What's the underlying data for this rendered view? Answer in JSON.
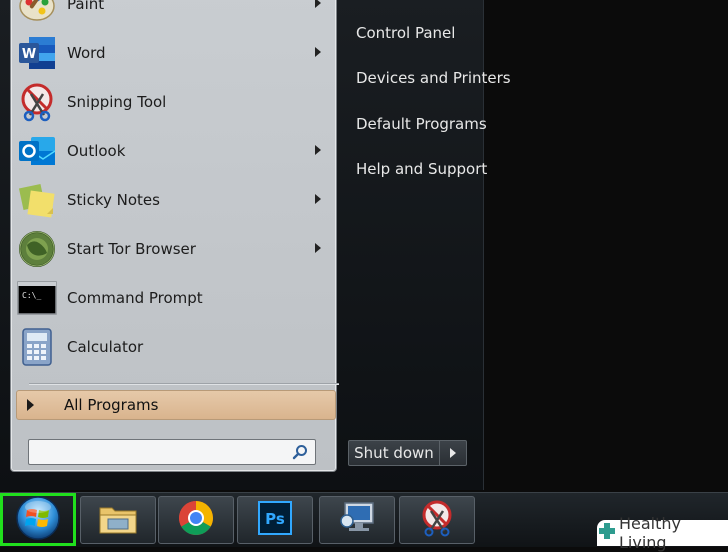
{
  "start_menu": {
    "programs": [
      {
        "label": "Paint",
        "icon": "paint-icon",
        "has_submenu": true
      },
      {
        "label": "Word",
        "icon": "word-icon",
        "has_submenu": true
      },
      {
        "label": "Snipping Tool",
        "icon": "snipping-tool-icon",
        "has_submenu": false
      },
      {
        "label": "Outlook",
        "icon": "outlook-icon",
        "has_submenu": true
      },
      {
        "label": "Sticky Notes",
        "icon": "sticky-notes-icon",
        "has_submenu": true
      },
      {
        "label": "Start Tor Browser",
        "icon": "tor-browser-icon",
        "has_submenu": true
      },
      {
        "label": "Command Prompt",
        "icon": "command-prompt-icon",
        "has_submenu": false
      },
      {
        "label": "Calculator",
        "icon": "calculator-icon",
        "has_submenu": false
      }
    ],
    "all_programs_label": "All Programs",
    "search_placeholder": "",
    "right_links": [
      "Control Panel",
      "Devices and Printers",
      "Default Programs",
      "Help and Support"
    ],
    "shutdown_label": "Shut down"
  },
  "taskbar": {
    "items": [
      "file-explorer-icon",
      "chrome-icon",
      "photoshop-icon",
      "network-computer-icon",
      "snipping-tool-icon"
    ],
    "photoshop_text": "Ps",
    "command_prompt_text": "C:\\_"
  },
  "watermark": {
    "label": "Healthy Living"
  },
  "colors": {
    "start_highlight": "#21e01d",
    "all_programs_bg": "#d9b48e",
    "word_blue": "#2b579a",
    "outlook_blue": "#0072c6"
  }
}
